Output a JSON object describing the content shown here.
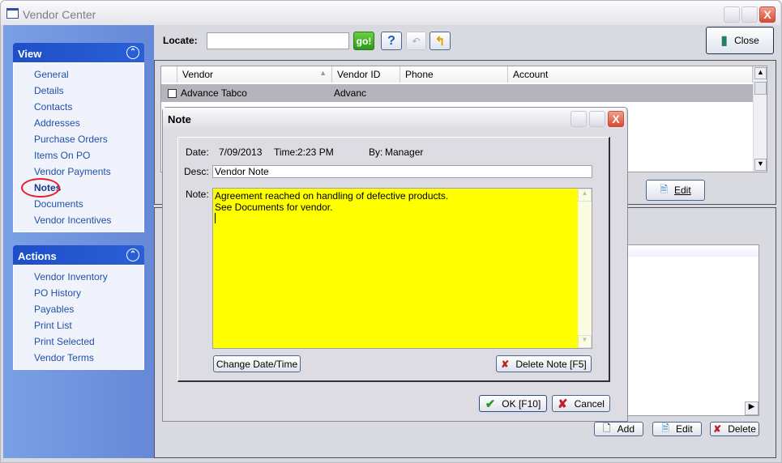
{
  "window": {
    "title": "Vendor Center",
    "close_glyph": "X"
  },
  "sidebar": {
    "view": {
      "title": "View",
      "items": [
        "General",
        "Details",
        "Contacts",
        "Addresses",
        "Purchase Orders",
        "Items On PO",
        "Vendor Payments",
        "Notes",
        "Documents",
        "Vendor Incentives"
      ],
      "selected": "Notes"
    },
    "actions": {
      "title": "Actions",
      "items": [
        "Vendor Inventory",
        "PO History",
        "Payables",
        "Print List",
        "Print Selected",
        "Vendor Terms"
      ]
    }
  },
  "toolbar": {
    "locate_label": "Locate:",
    "locate_value": "",
    "go_label": "go!",
    "help_label": "?",
    "close_label": "Close"
  },
  "vendor_grid": {
    "columns": [
      "Vendor",
      "Vendor ID",
      "Phone",
      "Account"
    ],
    "rows": [
      {
        "vendor": "Advance Tabco",
        "vendor_id": "Advanc",
        "phone": "",
        "account": ""
      }
    ]
  },
  "upper": {
    "edit_label": "Edit"
  },
  "lower": {
    "add_label": "Add",
    "edit_label": "Edit",
    "delete_label": "Delete"
  },
  "note_dialog": {
    "title": "Note",
    "date_label": "Date:",
    "date": "7/09/2013",
    "time_label": "Time:",
    "time": "2:23 PM",
    "by_label": "By:",
    "by": "Manager",
    "desc_label": "Desc:",
    "desc": "Vendor Note",
    "note_label": "Note:",
    "note_lines": [
      "Agreement reached on handling of defective products.",
      "See Documents for vendor."
    ],
    "note_bg": "#ffff00",
    "change_date_label": "Change Date/Time",
    "delete_note_label": "Delete Note [F5]",
    "ok_label": "OK [F10]",
    "cancel_label": "Cancel"
  },
  "colors": {
    "sidebar_header": "#2458cc",
    "selected_row": "#b4b4bc",
    "selection_circle": "#e0202a"
  }
}
